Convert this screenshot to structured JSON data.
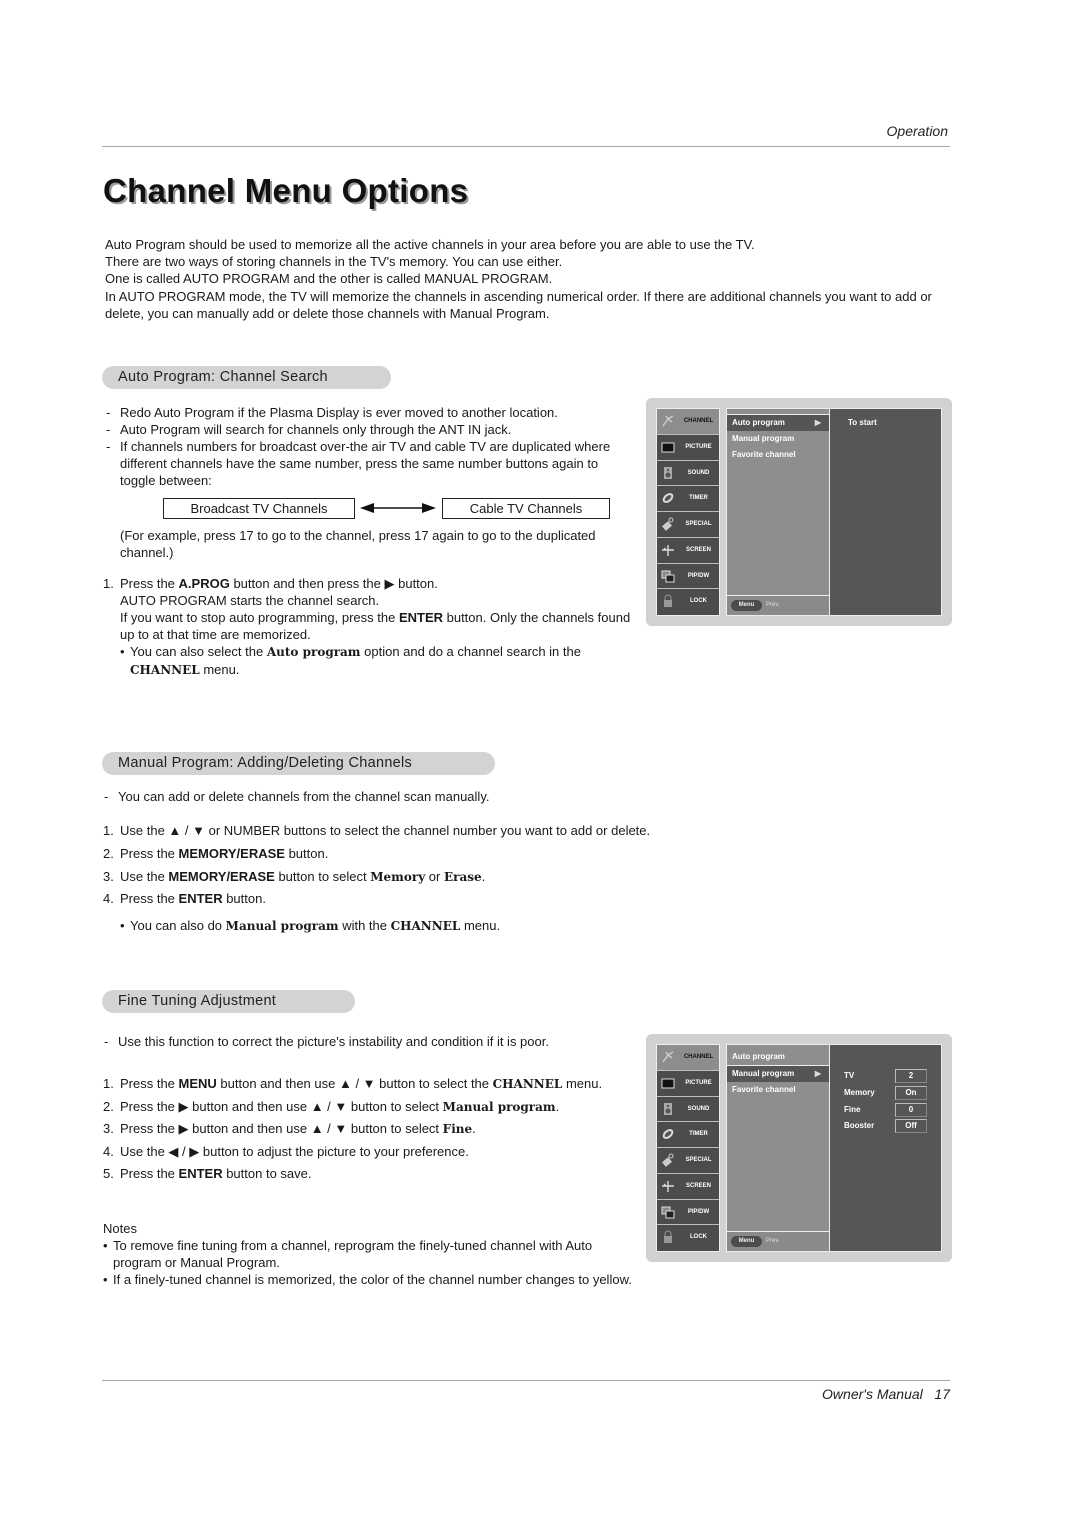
{
  "header": {
    "section": "Operation"
  },
  "title": "Channel Menu Options",
  "intro": [
    "Auto Program should be used to memorize all the active channels in your area before you are able to use the TV.",
    "There are two ways of storing channels in the TV's memory. You can use either.",
    "One is called AUTO PROGRAM and the other is called MANUAL PROGRAM.",
    "In AUTO PROGRAM mode, the TV will memorize the channels in ascending numerical order. If there are additional channels you want to add or delete, you can manually add or delete those channels with Manual Program."
  ],
  "auto_program": {
    "heading": "Auto Program: Channel Search",
    "notes": [
      "Redo Auto Program if the Plasma Display is ever moved to another location.",
      "Auto Program will search for channels only through the ANT IN jack.",
      "If channels numbers for broadcast over-the air TV and cable TV are duplicated where different channels have the same number, press the same number buttons again to toggle between:"
    ],
    "toggle": {
      "left": "Broadcast TV Channels",
      "right": "Cable TV Channels"
    },
    "example": "(For example, press 17 to go to the channel, press 17 again to go to the duplicated channel.)",
    "step1": {
      "num": "1.",
      "a": "Press the ",
      "b1": "A.PROG",
      "c": " button and then press the ",
      "arrow": "▶",
      "d": "  button.",
      "line2": "AUTO PROGRAM starts the channel search.",
      "line3a": "If you want to stop auto programming, press the ",
      "line3b": "ENTER",
      "line3c": " button. Only the channels found up to at that time are memorized.",
      "bullet_a": "You can also select the ",
      "bullet_b": "Auto program",
      "bullet_c": " option and do a channel search in the ",
      "bullet_d": "CHANNEL",
      "bullet_e": " menu."
    }
  },
  "manual_program": {
    "heading": "Manual Program: Adding/Deleting Channels",
    "note": "You can add or delete channels from the channel scan manually.",
    "steps": [
      {
        "num": "1.",
        "a": "Use the ",
        "updown": "▲ / ▼",
        "b": "  or NUMBER buttons to select the channel number you want to add or delete."
      },
      {
        "num": "2.",
        "a": "Press the ",
        "bold": "MEMORY/ERASE",
        "b": " button."
      },
      {
        "num": "3.",
        "a": "Use the ",
        "bold": "MEMORY/ERASE",
        "b": " button to select ",
        "s1": "Memory",
        "c": " or ",
        "s2": "Erase",
        "d": "."
      },
      {
        "num": "4.",
        "a": "Press the ",
        "bold": "ENTER",
        "b": " button."
      }
    ],
    "bullet": {
      "a": "You can also do ",
      "s1": "Manual program",
      "b": " with the ",
      "s2": "CHANNEL",
      "c": " menu."
    }
  },
  "fine_tuning": {
    "heading": "Fine Tuning Adjustment",
    "note": "Use this function to correct the picture's instability and condition if it is poor.",
    "steps": [
      {
        "num": "1.",
        "a": "Press the ",
        "bold": "MENU",
        "b": " button and then use ",
        "updown": "▲ / ▼",
        "c": "  button to select the ",
        "slab": "CHANNEL",
        "d": " menu."
      },
      {
        "num": "2.",
        "a": "Press the ",
        "arrow": "▶",
        "b": "  button and then use ",
        "updown": "▲ / ▼",
        "c": " button to select ",
        "slab": "Manual program",
        "d": "."
      },
      {
        "num": "3.",
        "a": "Press the ",
        "arrow": "▶",
        "b": "  button and then use ",
        "updown": "▲ / ▼",
        "c": " button to select ",
        "slab": "Fine",
        "d": "."
      },
      {
        "num": "4.",
        "a": "Use the ",
        "lr": "◀ / ▶",
        "b": " button to adjust the picture to your preference."
      },
      {
        "num": "5.",
        "a": "Press the ",
        "bold": "ENTER",
        "b": " button to save."
      }
    ],
    "notes_title": "Notes",
    "notes": [
      "To remove fine tuning from a channel, reprogram the finely-tuned channel with Auto program or Manual Program.",
      "If a finely-tuned channel is memorized, the color of the channel number changes to yellow."
    ]
  },
  "osd_sidebar": [
    "CHANNEL",
    "PICTURE",
    "SOUND",
    "TIMER",
    "SPECIAL",
    "SCREEN",
    "PIP/DW",
    "LOCK"
  ],
  "osd_menu": [
    "Auto program",
    "Manual program",
    "Favorite channel"
  ],
  "osd_arrow": "▶",
  "osd_footer": {
    "menu": "Menu",
    "prev": "Prev."
  },
  "osd1": {
    "selected": "Auto program",
    "hint": "To start"
  },
  "osd2": {
    "selected": "Manual program",
    "settings": [
      {
        "key": "TV",
        "value": "2"
      },
      {
        "key": "Memory",
        "value": "On"
      },
      {
        "key": "Fine",
        "value": "0"
      },
      {
        "key": "Booster",
        "value": "Off"
      }
    ]
  },
  "footer": {
    "label": "Owner's Manual",
    "page": "17"
  }
}
